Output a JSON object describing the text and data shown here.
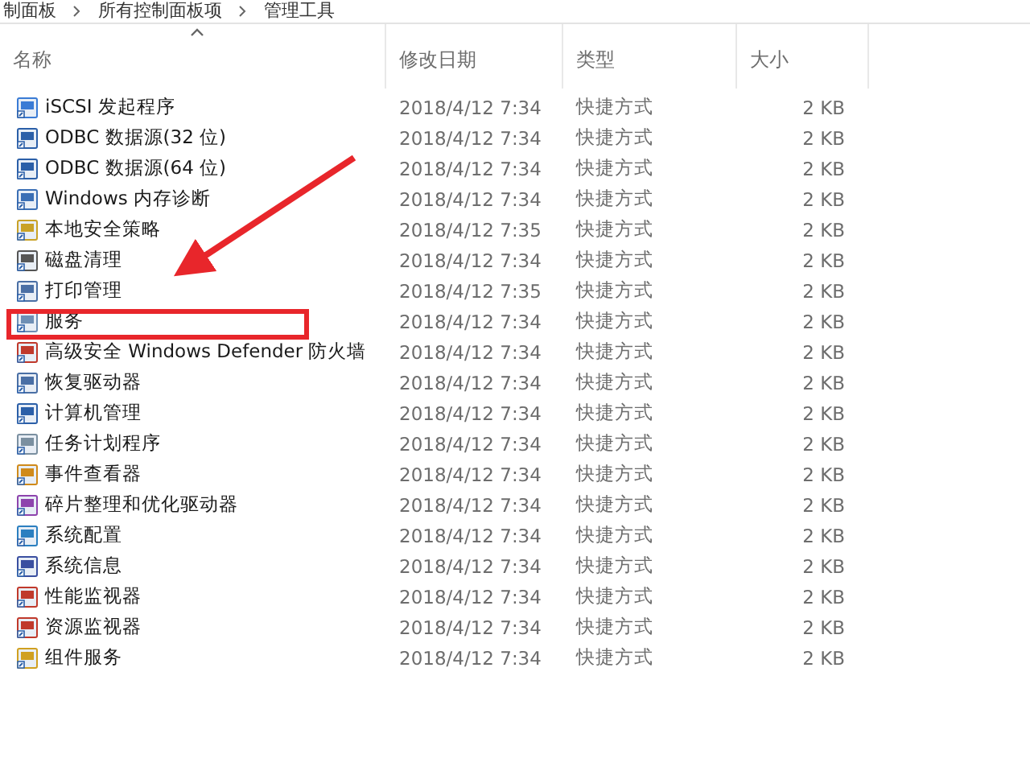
{
  "breadcrumb": [
    "制面板",
    "所有控制面板项",
    "管理工具"
  ],
  "table": {
    "columns": [
      "名称",
      "修改日期",
      "类型",
      "大小"
    ],
    "rows": [
      {
        "name": "iSCSI 发起程序",
        "date": "2018/4/12 7:34",
        "type": "快捷方式",
        "size": "2 KB",
        "highlighted": false
      },
      {
        "name": "ODBC 数据源(32 位)",
        "date": "2018/4/12 7:34",
        "type": "快捷方式",
        "size": "2 KB",
        "highlighted": false
      },
      {
        "name": "ODBC 数据源(64 位)",
        "date": "2018/4/12 7:34",
        "type": "快捷方式",
        "size": "2 KB",
        "highlighted": false
      },
      {
        "name": "Windows 内存诊断",
        "date": "2018/4/12 7:34",
        "type": "快捷方式",
        "size": "2 KB",
        "highlighted": false
      },
      {
        "name": "本地安全策略",
        "date": "2018/4/12 7:35",
        "type": "快捷方式",
        "size": "2 KB",
        "highlighted": false
      },
      {
        "name": "磁盘清理",
        "date": "2018/4/12 7:34",
        "type": "快捷方式",
        "size": "2 KB",
        "highlighted": false
      },
      {
        "name": "打印管理",
        "date": "2018/4/12 7:35",
        "type": "快捷方式",
        "size": "2 KB",
        "highlighted": false
      },
      {
        "name": "服务",
        "date": "2018/4/12 7:34",
        "type": "快捷方式",
        "size": "2 KB",
        "highlighted": true
      },
      {
        "name": "高级安全 Windows Defender 防火墙",
        "date": "2018/4/12 7:34",
        "type": "快捷方式",
        "size": "2 KB",
        "highlighted": false
      },
      {
        "name": "恢复驱动器",
        "date": "2018/4/12 7:34",
        "type": "快捷方式",
        "size": "2 KB",
        "highlighted": false
      },
      {
        "name": "计算机管理",
        "date": "2018/4/12 7:34",
        "type": "快捷方式",
        "size": "2 KB",
        "highlighted": false
      },
      {
        "name": "任务计划程序",
        "date": "2018/4/12 7:34",
        "type": "快捷方式",
        "size": "2 KB",
        "highlighted": false
      },
      {
        "name": "事件查看器",
        "date": "2018/4/12 7:34",
        "type": "快捷方式",
        "size": "2 KB",
        "highlighted": false
      },
      {
        "name": "碎片整理和优化驱动器",
        "date": "2018/4/12 7:34",
        "type": "快捷方式",
        "size": "2 KB",
        "highlighted": false
      },
      {
        "name": "系统配置",
        "date": "2018/4/12 7:34",
        "type": "快捷方式",
        "size": "2 KB",
        "highlighted": false
      },
      {
        "name": "系统信息",
        "date": "2018/4/12 7:34",
        "type": "快捷方式",
        "size": "2 KB",
        "highlighted": false
      },
      {
        "name": "性能监视器",
        "date": "2018/4/12 7:34",
        "type": "快捷方式",
        "size": "2 KB",
        "highlighted": false
      },
      {
        "name": "资源监视器",
        "date": "2018/4/12 7:34",
        "type": "快捷方式",
        "size": "2 KB",
        "highlighted": false
      },
      {
        "name": "组件服务",
        "date": "2018/4/12 7:34",
        "type": "快捷方式",
        "size": "2 KB",
        "highlighted": false
      }
    ]
  }
}
